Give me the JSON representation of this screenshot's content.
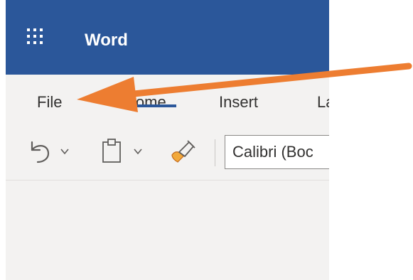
{
  "app": {
    "title": "Word"
  },
  "colors": {
    "titlebar": "#2b579a",
    "annotation_arrow": "#ed7d31"
  },
  "tabs": [
    {
      "label": "File"
    },
    {
      "label": "Home",
      "selected": true
    },
    {
      "label": "Insert"
    },
    {
      "label": "La"
    }
  ],
  "toolbar": {
    "icons": [
      "undo-icon",
      "clipboard-paste-icon",
      "format-painter-icon"
    ],
    "font_name_value": "Calibri (Boc"
  }
}
